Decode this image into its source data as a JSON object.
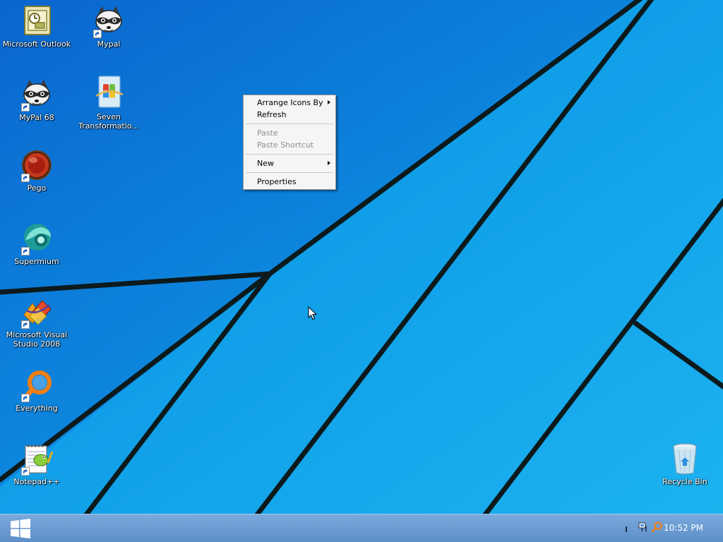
{
  "desktop": {
    "icons": [
      {
        "label": "Microsoft Outlook",
        "icon": "outlook-icon"
      },
      {
        "label": "Mypal",
        "icon": "raccoon-icon"
      },
      {
        "label": "MyPal 68",
        "icon": "raccoon-icon"
      },
      {
        "label": "Seven Transformatio...",
        "icon": "windows-flag-icon"
      },
      {
        "label": "Pego",
        "icon": "red-orb-icon"
      },
      {
        "label": "Supermium",
        "icon": "teal-globe-icon"
      },
      {
        "label": "Microsoft Visual Studio 2008",
        "icon": "visual-studio-icon"
      },
      {
        "label": "Everything",
        "icon": "magnifier-icon"
      },
      {
        "label": "Notepad++",
        "icon": "notepad-icon"
      },
      {
        "label": "Recycle Bin",
        "icon": "recycle-bin-icon"
      }
    ]
  },
  "context_menu": {
    "items": [
      {
        "label": "Arrange Icons By",
        "enabled": true,
        "submenu": true
      },
      {
        "label": "Refresh",
        "enabled": true,
        "submenu": false
      },
      {
        "label": "Paste",
        "enabled": false,
        "submenu": false
      },
      {
        "label": "Paste Shortcut",
        "enabled": false,
        "submenu": false
      },
      {
        "label": "New",
        "enabled": true,
        "submenu": true
      },
      {
        "label": "Properties",
        "enabled": true,
        "submenu": false
      }
    ]
  },
  "taskbar": {
    "start_icon": "windows-logo-icon",
    "tray_icons": [
      "network-icon",
      "search-icon"
    ],
    "clock": "10:52 PM"
  },
  "colors": {
    "wallpaper": "#1ba1e2",
    "taskbar": "#6c9bd2",
    "menu_bg": "#f5f5f5"
  }
}
